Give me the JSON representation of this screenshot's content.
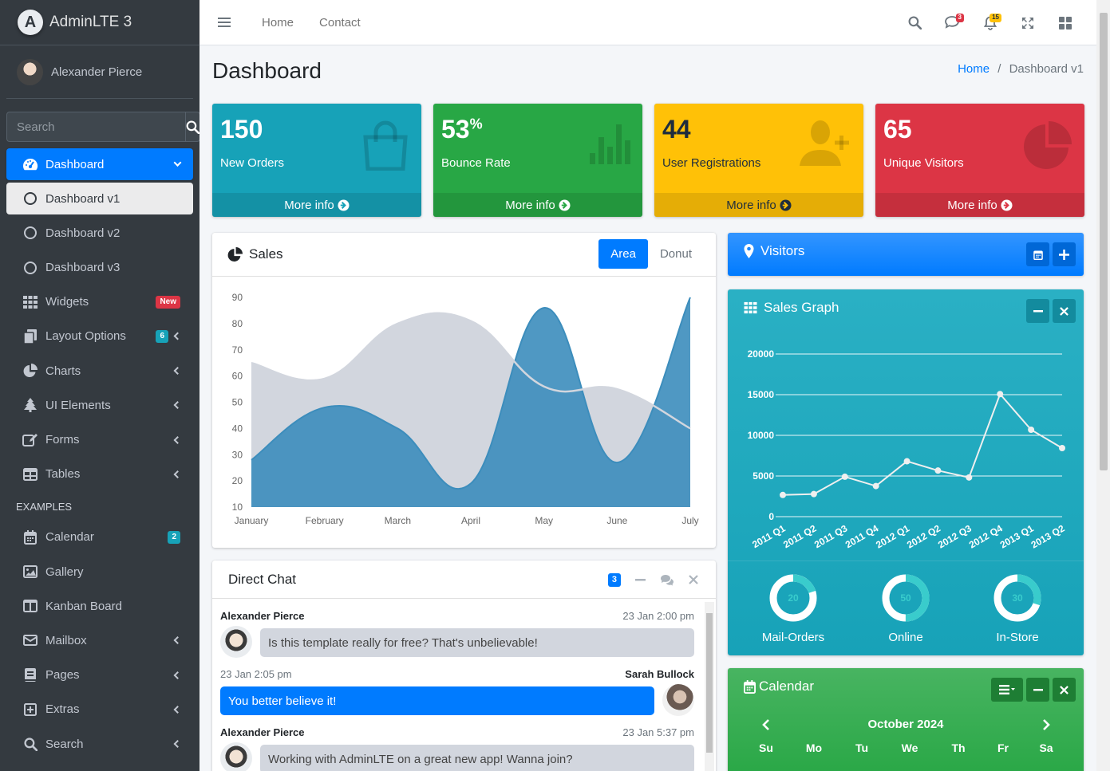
{
  "brand": {
    "name": "AdminLTE 3",
    "logo_letter": "A"
  },
  "user": {
    "name": "Alexander Pierce"
  },
  "sidebar_search": {
    "placeholder": "Search"
  },
  "nav": {
    "dashboard": "Dashboard",
    "dashboard_v1": "Dashboard v1",
    "dashboard_v2": "Dashboard v2",
    "dashboard_v3": "Dashboard v3",
    "widgets": "Widgets",
    "widgets_badge": "New",
    "layout_options": "Layout Options",
    "layout_badge": "6",
    "charts": "Charts",
    "ui_elements": "UI Elements",
    "forms": "Forms",
    "tables": "Tables",
    "examples_header": "EXAMPLES",
    "calendar": "Calendar",
    "calendar_badge": "2",
    "gallery": "Gallery",
    "kanban": "Kanban Board",
    "mailbox": "Mailbox",
    "pages": "Pages",
    "extras": "Extras",
    "search": "Search"
  },
  "topbar": {
    "home": "Home",
    "contact": "Contact",
    "messages_count": "3",
    "notifications_count": "15"
  },
  "page": {
    "title": "Dashboard",
    "breadcrumb_home": "Home",
    "breadcrumb_current": "Dashboard v1"
  },
  "info_boxes": [
    {
      "value": "150",
      "suffix": "",
      "label": "New Orders",
      "footer": "More info",
      "color": "#17a2b8"
    },
    {
      "value": "53",
      "suffix": "%",
      "label": "Bounce Rate",
      "footer": "More info",
      "color": "#28a745"
    },
    {
      "value": "44",
      "suffix": "",
      "label": "User Registrations",
      "footer": "More info",
      "color": "#ffc107"
    },
    {
      "value": "65",
      "suffix": "",
      "label": "Unique Visitors",
      "footer": "More info",
      "color": "#dc3545"
    }
  ],
  "sales_card": {
    "title": "Sales",
    "tab_area": "Area",
    "tab_donut": "Donut"
  },
  "visitors_card": {
    "title": "Visitors"
  },
  "sales_graph_card": {
    "title": "Sales Graph"
  },
  "knobs": [
    {
      "label": "Mail-Orders",
      "value": 20
    },
    {
      "label": "Online",
      "value": 50
    },
    {
      "label": "In-Store",
      "value": 30
    }
  ],
  "calendar_card": {
    "title": "Calendar",
    "month": "October 2024",
    "weekdays": [
      "Su",
      "Mo",
      "Tu",
      "We",
      "Th",
      "Fr",
      "Sa"
    ]
  },
  "chat": {
    "title": "Direct Chat",
    "badge": "3",
    "messages": [
      {
        "name": "Alexander Pierce",
        "time": "23 Jan 2:00 pm",
        "text": "Is this template really for free? That's unbelievable!"
      },
      {
        "name": "Sarah Bullock",
        "time": "23 Jan 2:05 pm",
        "text": "You better believe it!"
      },
      {
        "name": "Alexander Pierce",
        "time": "23 Jan 5:37 pm",
        "text": "Working with AdminLTE on a great new app! Wanna join?"
      }
    ]
  },
  "chart_data": [
    {
      "type": "area",
      "categories": [
        "January",
        "February",
        "March",
        "April",
        "May",
        "June",
        "July"
      ],
      "ylim": [
        10,
        90
      ],
      "yticks": [
        10,
        20,
        30,
        40,
        50,
        60,
        70,
        80,
        90
      ],
      "series": [
        {
          "values": [
            65,
            59,
            80,
            81,
            56,
            55,
            40
          ],
          "color": "#d2d6de"
        },
        {
          "values": [
            28,
            48,
            40,
            19,
            86,
            27,
            90
          ],
          "color": "#3c8dbc"
        }
      ]
    },
    {
      "type": "line",
      "categories": [
        "2011 Q1",
        "2011 Q2",
        "2011 Q3",
        "2011 Q4",
        "2012 Q1",
        "2012 Q2",
        "2012 Q3",
        "2012 Q4",
        "2013 Q1",
        "2013 Q2"
      ],
      "values": [
        2666,
        2778,
        4912,
        3767,
        6810,
        5670,
        4820,
        15073,
        10687,
        8432
      ],
      "ylim": [
        0,
        20000
      ],
      "yticks": [
        0,
        5000,
        10000,
        15000,
        20000
      ]
    }
  ]
}
